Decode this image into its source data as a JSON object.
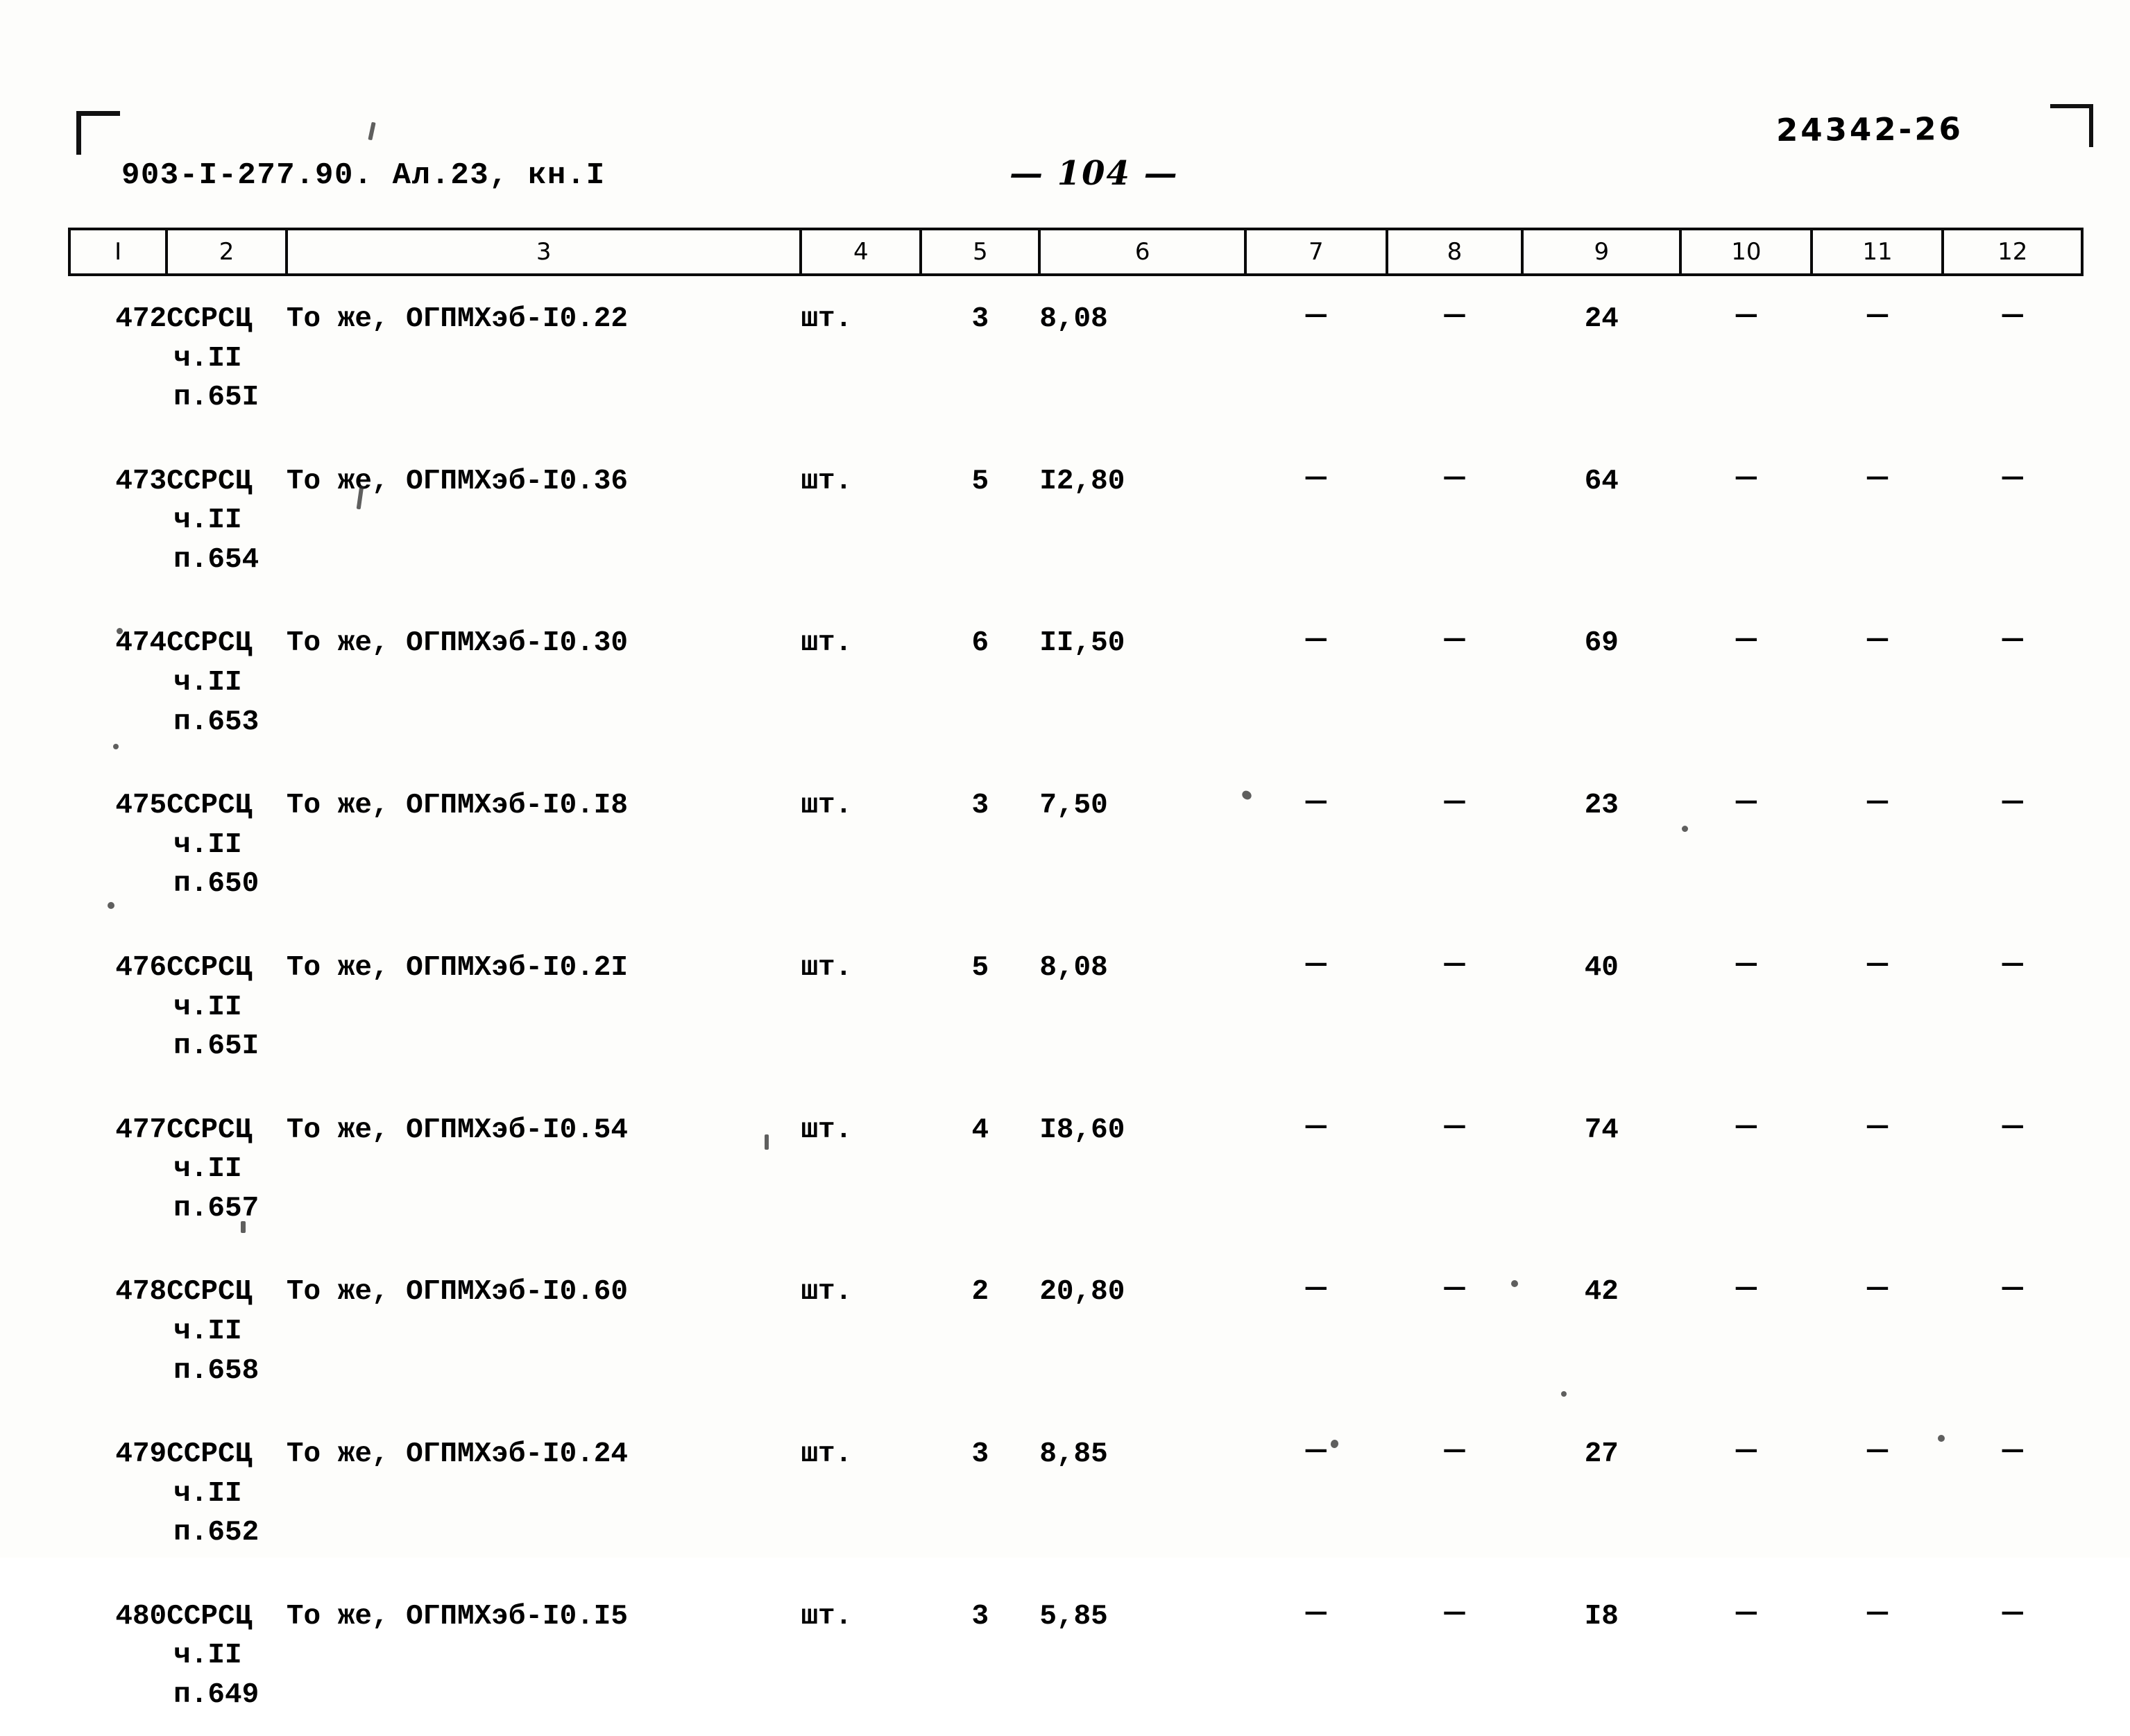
{
  "header": {
    "doc_code": "903-I-277.90. Ал.23, кн.I",
    "archive_number": "24342-26",
    "page_label": "— 104 —"
  },
  "table": {
    "column_headers": [
      "I",
      "2",
      "3",
      "4",
      "5",
      "6",
      "7",
      "8",
      "9",
      "10",
      "11",
      "12"
    ],
    "dash": "—",
    "rows": [
      {
        "num": "472",
        "justification": [
          "ССРСЦ",
          "ч.II",
          "п.65I"
        ],
        "description": "То же, ОГПМХэб-I0.22",
        "unit": "шт.",
        "qty": "3",
        "mass": "8,08",
        "col7": "—",
        "col8": "—",
        "total": "24",
        "col10": "—",
        "col11": "—",
        "col12": "—"
      },
      {
        "num": "473",
        "justification": [
          "ССРСЦ",
          "ч.II",
          "п.654"
        ],
        "description": "То же, ОГПМХэб-I0.36",
        "unit": "шт.",
        "qty": "5",
        "mass": "I2,80",
        "col7": "—",
        "col8": "—",
        "total": "64",
        "col10": "—",
        "col11": "—",
        "col12": "—"
      },
      {
        "num": "474",
        "justification": [
          "ССРСЦ",
          "ч.II",
          "п.653"
        ],
        "description": "То же, ОГПМХэб-I0.30",
        "unit": "шт.",
        "qty": "6",
        "mass": "II,50",
        "col7": "—",
        "col8": "—",
        "total": "69",
        "col10": "—",
        "col11": "—",
        "col12": "—"
      },
      {
        "num": "475",
        "justification": [
          "ССРСЦ",
          "ч.II",
          "п.650"
        ],
        "description": "То же, ОГПМХэб-I0.I8",
        "unit": "шт.",
        "qty": "3",
        "mass": "7,50",
        "col7": "—",
        "col8": "—",
        "total": "23",
        "col10": "—",
        "col11": "—",
        "col12": "—"
      },
      {
        "num": "476",
        "justification": [
          "ССРСЦ",
          "ч.II",
          "п.65I"
        ],
        "description": "То же, ОГПМХэб-I0.2I",
        "unit": "шт.",
        "qty": "5",
        "mass": "8,08",
        "col7": "—",
        "col8": "—",
        "total": "40",
        "col10": "—",
        "col11": "—",
        "col12": "—"
      },
      {
        "num": "477",
        "justification": [
          "ССРСЦ",
          "ч.II",
          "п.657"
        ],
        "description": "То же, ОГПМХэб-I0.54",
        "unit": "шт.",
        "qty": "4",
        "mass": "I8,60",
        "col7": "—",
        "col8": "—",
        "total": "74",
        "col10": "—",
        "col11": "—",
        "col12": "—"
      },
      {
        "num": "478",
        "justification": [
          "ССРСЦ",
          "ч.II",
          "п.658"
        ],
        "description": "То же, ОГПМХэб-I0.60",
        "unit": "шт.",
        "qty": "2",
        "mass": "20,80",
        "col7": "—",
        "col8": "—",
        "total": "42",
        "col10": "—",
        "col11": "—",
        "col12": "—"
      },
      {
        "num": "479",
        "justification": [
          "ССРСЦ",
          "ч.II",
          "п.652"
        ],
        "description": "То же, ОГПМХэб-I0.24",
        "unit": "шт.",
        "qty": "3",
        "mass": "8,85",
        "col7": "—",
        "col8": "—",
        "total": "27",
        "col10": "—",
        "col11": "—",
        "col12": "—"
      },
      {
        "num": "480",
        "justification": [
          "ССРСЦ",
          "ч.II",
          "п.649"
        ],
        "description": "То же, ОГПМХэб-I0.I5",
        "unit": "шт.",
        "qty": "3",
        "mass": "5,85",
        "col7": "—",
        "col8": "—",
        "total": "I8",
        "col10": "—",
        "col11": "—",
        "col12": "—"
      }
    ]
  }
}
